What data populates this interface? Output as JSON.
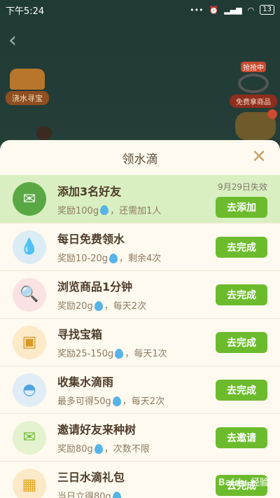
{
  "statusbar": {
    "time": "下午5:24",
    "battery": "13"
  },
  "background": {
    "left_badge_label": "浇水寻宝",
    "right_badge_tag": "抢抢中",
    "right_badge_label": "免费拿商品"
  },
  "sheet": {
    "title": "领水滴",
    "tasks": [
      {
        "name": "添加3名好友",
        "reward_prefix": "奖励100g",
        "reward_suffix": "，还需加1人",
        "expire": "9月29日失效",
        "button": "去添加",
        "icon": "gift-envelope-icon",
        "icon_bg": "#5aa843"
      },
      {
        "name": "每日免费领水",
        "reward_prefix": "奖励10-20g",
        "reward_suffix": "，剩余4次",
        "expire": "",
        "button": "去完成",
        "icon": "water-drop-icon",
        "icon_bg": "#dcecf4"
      },
      {
        "name": "浏览商品1分钟",
        "reward_prefix": "奖励20g",
        "reward_suffix": "，每天2次",
        "expire": "",
        "button": "去完成",
        "icon": "magnifier-icon",
        "icon_bg": "#fbe2e2"
      },
      {
        "name": "寻找宝箱",
        "reward_prefix": "奖励25-150g",
        "reward_suffix": "，每天1次",
        "expire": "",
        "button": "去完成",
        "icon": "treasure-chest-icon",
        "icon_bg": "#fbe9c7"
      },
      {
        "name": "收集水滴雨",
        "reward_prefix": "最多可得50g",
        "reward_suffix": "，每天2次",
        "expire": "",
        "button": "去完成",
        "icon": "water-pot-icon",
        "icon_bg": "#e0ecf6"
      },
      {
        "name": "邀请好友来种树",
        "reward_prefix": "奖励80g",
        "reward_suffix": "，次数不限",
        "expire": "",
        "button": "去邀请",
        "icon": "invite-envelope-icon",
        "icon_bg": "#e4f2cf"
      },
      {
        "name": "三日水滴礼包",
        "reward_prefix": "当日立得80g",
        "reward_suffix": "",
        "expire": "",
        "button": "去完成",
        "icon": "gift-box-icon",
        "icon_bg": "#fbe9c7"
      }
    ]
  },
  "watermark": "Baidu 经验"
}
